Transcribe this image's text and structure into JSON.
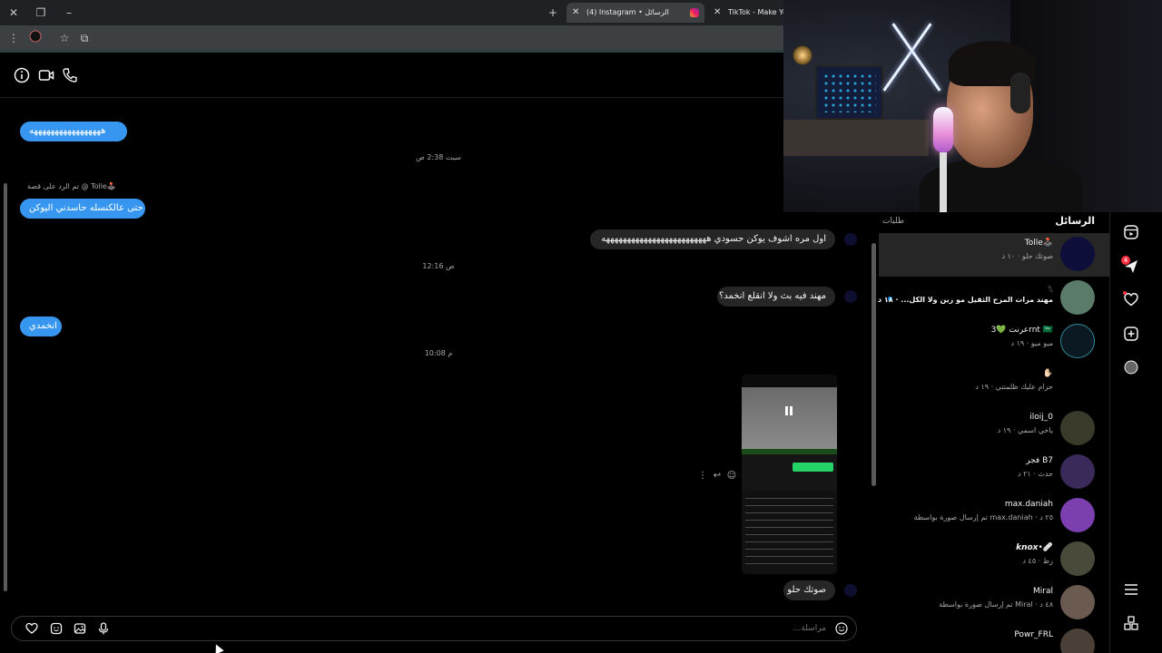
{
  "browser": {
    "tabs": [
      {
        "title": "(4) Instagram • الرسائل",
        "active": true
      },
      {
        "title": "TikTok - Make Yo",
        "active": false
      }
    ],
    "new_tab_label": "+"
  },
  "chat": {
    "messages": [
      {
        "kind": "in",
        "text": "هههههههههههههههههه"
      },
      {
        "kind": "stamp",
        "text": "سبت 2:38 ص"
      },
      {
        "kind": "reply_note",
        "text": "تم الرد على قصة @ Tolle🕹️"
      },
      {
        "kind": "in",
        "text": "حتى عالكنسله حاسدني اليوكن"
      },
      {
        "kind": "out",
        "text": "اول مره اشوف يوكن حسودي هههههههههههههههههههههههههه"
      },
      {
        "kind": "stamp",
        "text": "12:16 ص"
      },
      {
        "kind": "out",
        "text": "مهند فيه بث ولا انقلع انخمد؟"
      },
      {
        "kind": "in",
        "text": "انخمدي"
      },
      {
        "kind": "stamp",
        "text": "10:08 م"
      },
      {
        "kind": "out",
        "text": "صوتك حلو"
      }
    ],
    "composer_placeholder": "مراسلة..."
  },
  "inbox": {
    "title": "الرسائل",
    "requests_label": "طلبات",
    "conversations": [
      {
        "name": "Tolle🕹️",
        "preview": "صوتك حلو · ١٠ د",
        "avatar_color": "#0d0f3a",
        "active": true,
        "unread": false
      },
      {
        "name": "𓆩",
        "preview": "مهند مرات المزح الثقيل مو زين ولا الكل... · ١٨ د",
        "avatar_color": "#5a7a6a",
        "active": false,
        "unread": true
      },
      {
        "name": "عرنت 💚3rnt 🇸🇦",
        "preview": "ميو ميو · ١٩ د",
        "avatar_color": "#0b1a22",
        "active": false,
        "unread": false
      },
      {
        "name": "✋🏻",
        "preview": "حرام عليك ظلمتني · ١٩ د",
        "avatar_color": "#000000",
        "active": false,
        "unread": false
      },
      {
        "name": "iloij_0",
        "preview": "ياخي اسمي · ١٩ د",
        "avatar_color": "#3a3a2a",
        "active": false,
        "unread": false
      },
      {
        "name": "فجر B7",
        "preview": "حدث · ٢١ د",
        "avatar_color": "#3a2a5a",
        "active": false,
        "unread": false
      },
      {
        "name": "max.daniah",
        "preview": "تم إرسال صورة بواسطة max.daniah · ٢٥ د",
        "avatar_color": "#7b3fb0",
        "active": false,
        "unread": false
      },
      {
        "name": "𝙠𝙣𝙤𝙭•🩹",
        "preview": "زط · ٤٥ د",
        "avatar_color": "#4a4a3a",
        "active": false,
        "unread": false
      },
      {
        "name": "Miral",
        "preview": "تم إرسال صورة بواسطة Miral · ٤٨ د",
        "avatar_color": "#6a5a50",
        "active": false,
        "unread": false
      },
      {
        "name": "Powr_FRL",
        "preview": "",
        "avatar_color": "#4a4038",
        "active": false,
        "unread": false
      }
    ]
  },
  "nav": {
    "badge_count": "4"
  },
  "colors": {
    "accent": "#3797f0",
    "bubble_out": "#262626",
    "background": "#000000"
  },
  "icons": [
    "info-icon",
    "video-call-icon",
    "phone-icon",
    "heart-icon",
    "sticker-icon",
    "image-icon",
    "mic-icon",
    "emoji-icon",
    "reels-icon",
    "explore-icon",
    "create-icon",
    "menu-icon"
  ]
}
